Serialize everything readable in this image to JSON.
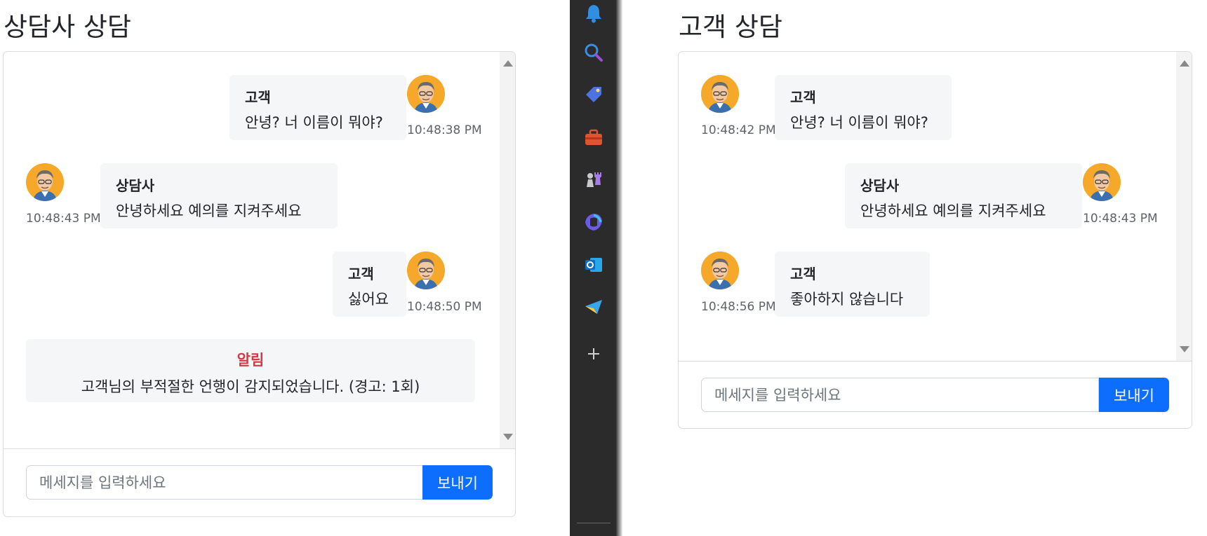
{
  "left": {
    "title": "상담사 상담",
    "messages": [
      {
        "sender": "고객",
        "text": "안녕? 너 이름이 뭐야?",
        "time": "10:48:38 PM"
      },
      {
        "sender": "상담사",
        "text": "안녕하세요 예의를 지켜주세요",
        "time": "10:48:43 PM"
      },
      {
        "sender": "고객",
        "text": "싫어요",
        "time": "10:48:50 PM"
      }
    ],
    "notice": {
      "title": "알림",
      "text": "고객님의 부적절한 언행이 감지되었습니다. (경고: 1회)"
    },
    "input_placeholder": "메세지를 입력하세요",
    "send_label": "보내기"
  },
  "right": {
    "title": "고객 상담",
    "messages": [
      {
        "sender": "고객",
        "text": "안녕? 너 이름이 뭐야?",
        "time": "10:48:42 PM"
      },
      {
        "sender": "상담사",
        "text": "안녕하세요 예의를 지켜주세요",
        "time": "10:48:43 PM"
      },
      {
        "sender": "고객",
        "text": "좋아하지 않습니다",
        "time": "10:48:56 PM"
      }
    ],
    "input_placeholder": "메세지를 입력하세요",
    "send_label": "보내기"
  },
  "sidebar": {
    "icons": [
      "bell-icon",
      "search-icon",
      "tag-icon",
      "toolbox-icon",
      "chess-icon",
      "copilot-icon",
      "outlook-icon",
      "send-icon",
      "plus-icon"
    ]
  },
  "colors": {
    "accent": "#0d6efd",
    "notice_title": "#dc3545",
    "bubble_bg": "#f5f6f8",
    "avatar_bg": "#f6a82a",
    "sidebar_bg": "#2b2b2b"
  }
}
